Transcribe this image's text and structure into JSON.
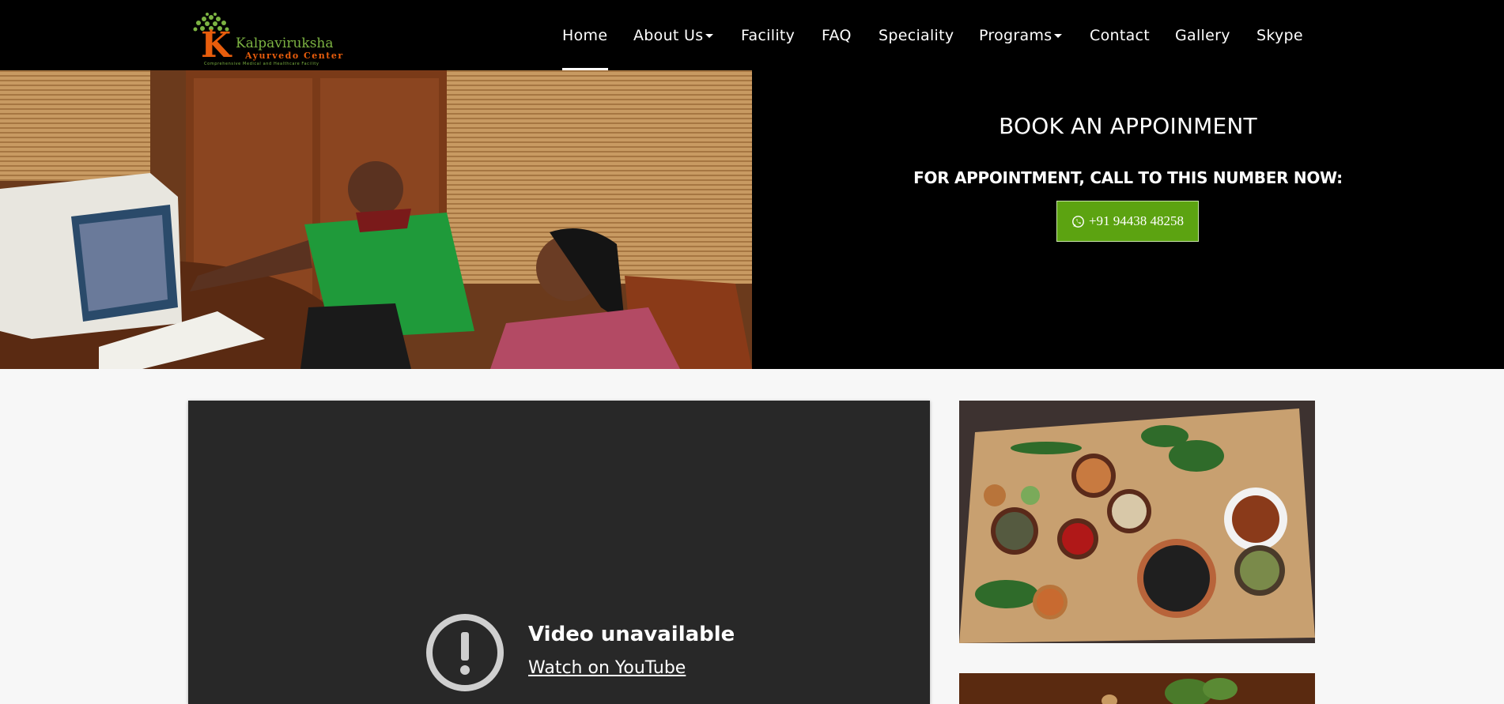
{
  "brand": {
    "logo_letter": "K",
    "name": "Kalpaviruksha",
    "subtitle": "Ayurvedo Center",
    "tagline": "Comprehensive Medical and Healthcare Facility"
  },
  "nav": {
    "items": [
      {
        "label": "Home",
        "active": true,
        "dropdown": false
      },
      {
        "label": "About Us",
        "active": false,
        "dropdown": true
      },
      {
        "label": "Facility",
        "active": false,
        "dropdown": false
      },
      {
        "label": "FAQ",
        "active": false,
        "dropdown": false
      },
      {
        "label": "Speciality",
        "active": false,
        "dropdown": false
      },
      {
        "label": "Programs",
        "active": false,
        "dropdown": true
      },
      {
        "label": "Contact",
        "active": false,
        "dropdown": false
      },
      {
        "label": "Gallery",
        "active": false,
        "dropdown": false
      },
      {
        "label": "Skype",
        "active": false,
        "dropdown": false
      }
    ]
  },
  "appointment": {
    "title": "BOOK AN APPOINMENT",
    "subtitle": "FOR APPOINTMENT, CALL TO THIS NUMBER NOW:",
    "phone": "+91 94438 48258",
    "phone_icon": "whatsapp-icon",
    "button_color": "#5ca311"
  },
  "video": {
    "title": "Video unavailable",
    "link": "Watch on YouTube",
    "icon": "alert-circle-icon"
  },
  "colors": {
    "nav_bg": "#000000",
    "page_bg": "#f7f7f7",
    "accent_green": "#5ca311",
    "logo_orange": "#e85d0c",
    "logo_green": "#7cb342"
  }
}
